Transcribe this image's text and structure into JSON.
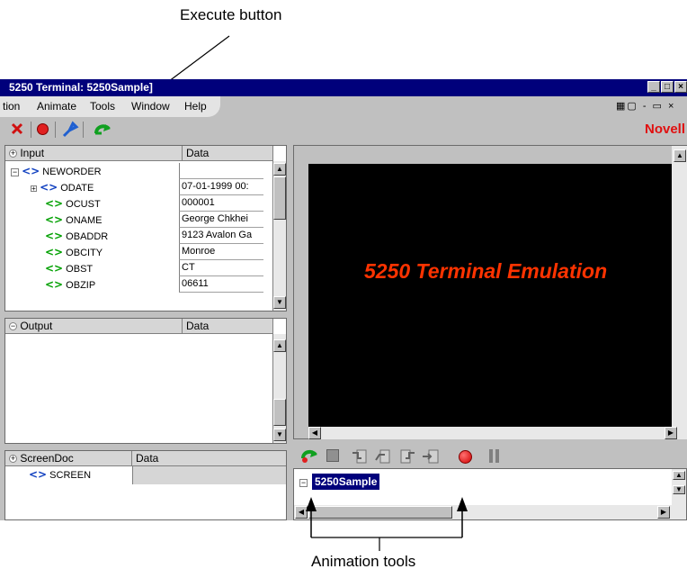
{
  "annotations": {
    "execute_label": "Execute button",
    "animation_label": "Animation tools"
  },
  "window": {
    "title": "5250 Terminal: 5250Sample]",
    "menus": [
      "tion",
      "Animate",
      "Tools",
      "Window",
      "Help"
    ],
    "brand": "Novell",
    "icons": [
      "stop-x-icon",
      "record-circle-icon",
      "connect-icon",
      "execute-arrow-icon"
    ]
  },
  "input_panel": {
    "header": "Input",
    "data_header": "Data",
    "root": "NEWORDER",
    "rows": [
      {
        "name": "ODATE",
        "value": "07-01-1999 00:"
      },
      {
        "name": "OCUST",
        "value": "000001"
      },
      {
        "name": "ONAME",
        "value": "George Chkhei"
      },
      {
        "name": "OBADDR",
        "value": "9123 Avalon Ga"
      },
      {
        "name": "OBCITY",
        "value": "Monroe"
      },
      {
        "name": "OBST",
        "value": "CT"
      },
      {
        "name": "OBZIP",
        "value": "06611"
      }
    ]
  },
  "output_panel": {
    "header": "Output",
    "data_header": "Data"
  },
  "screendoc_panel": {
    "header": "ScreenDoc",
    "data_header": "Data",
    "rows": [
      {
        "name": "SCREEN"
      }
    ]
  },
  "terminal": {
    "text": "5250 Terminal Emulation"
  },
  "animation": {
    "icons": [
      "animate-play-icon",
      "animate-stop-icon",
      "step-into-icon",
      "step-over-icon",
      "step-out-icon",
      "animate-record-icon",
      "animate-pause-icon"
    ],
    "tree_root": "5250Sample"
  },
  "colors": {
    "titlebar": "#00007b",
    "brand": "#e01010",
    "terminal_bg": "#000000",
    "terminal_text": "#ff3300",
    "tag_blue": "#1040c0",
    "tag_green": "#00a000"
  }
}
